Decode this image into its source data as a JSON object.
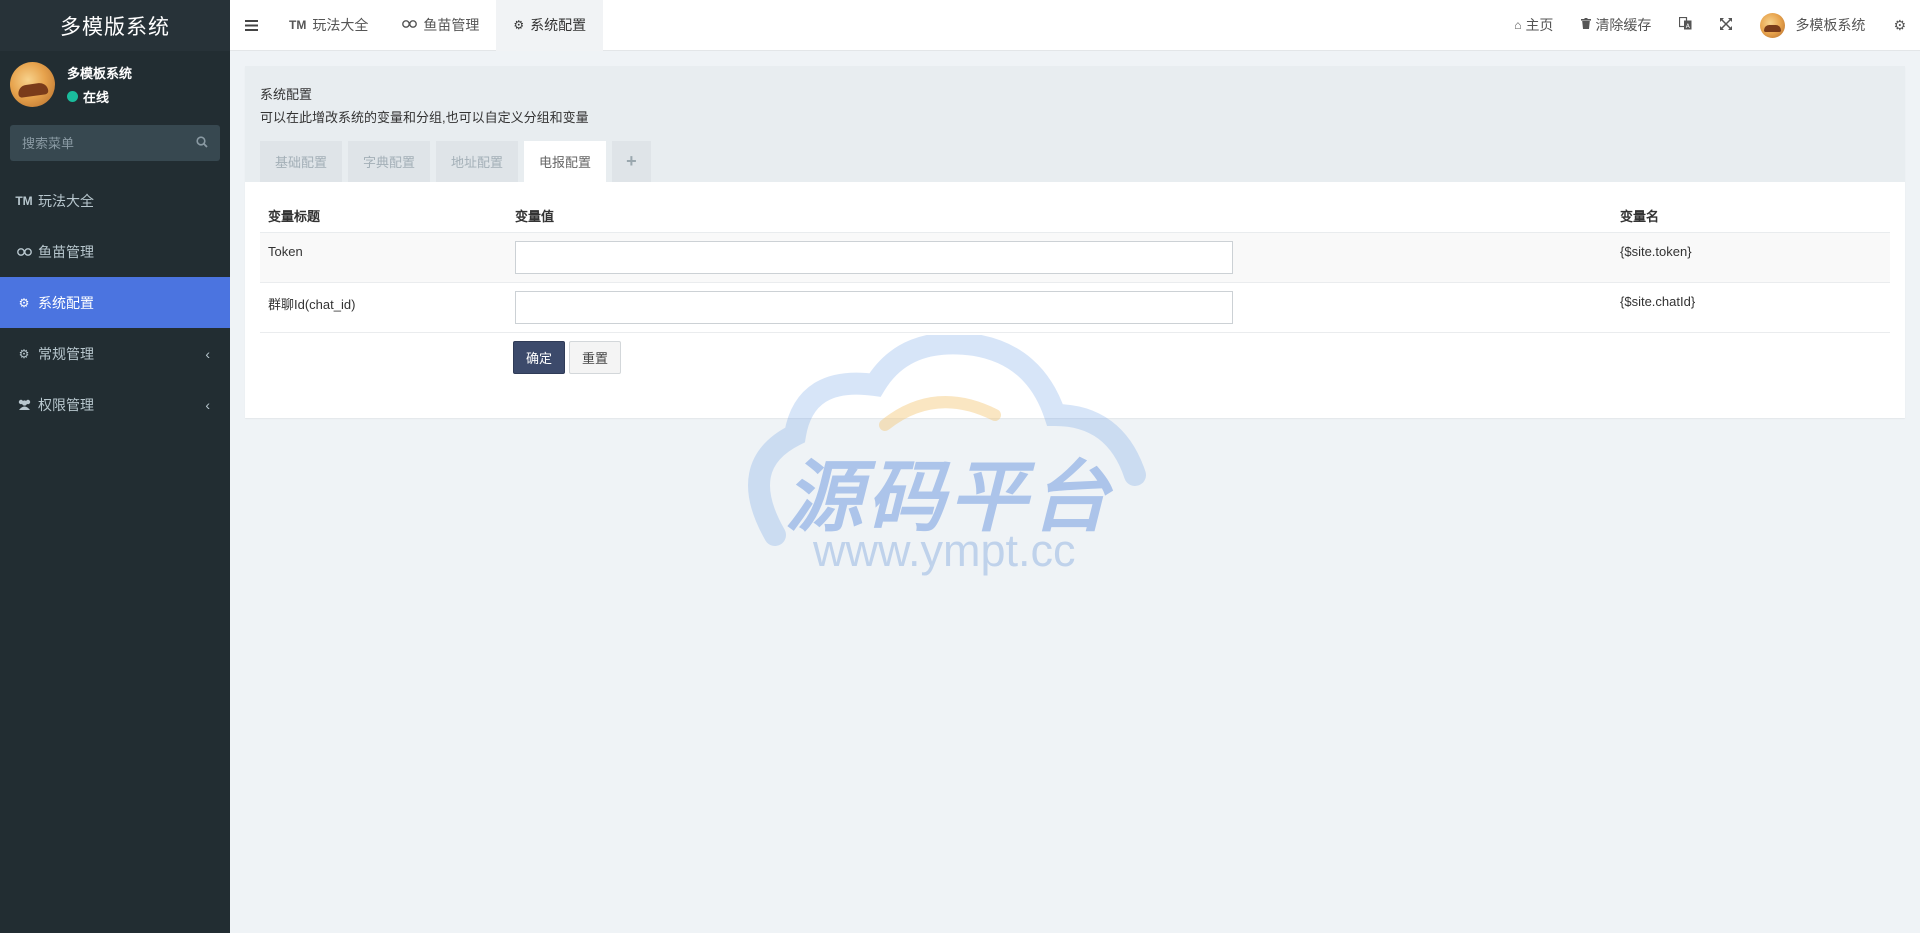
{
  "app": {
    "logo": "多模版系统"
  },
  "user": {
    "name": "多模板系统",
    "status": "在线"
  },
  "search": {
    "placeholder": "搜索菜单"
  },
  "sidebar": {
    "items": [
      {
        "label": "玩法大全",
        "icon": "trademark-icon"
      },
      {
        "label": "鱼苗管理",
        "icon": "binoculars-icon"
      },
      {
        "label": "系统配置",
        "icon": "gear-icon"
      },
      {
        "label": "常规管理",
        "icon": "cogs-icon"
      },
      {
        "label": "权限管理",
        "icon": "users-icon"
      }
    ]
  },
  "navbar": {
    "tabs": [
      {
        "label": "玩法大全"
      },
      {
        "label": "鱼苗管理"
      },
      {
        "label": "系统配置"
      }
    ],
    "home": "主页",
    "clear_cache": "清除缓存",
    "user": "多模板系统"
  },
  "panel": {
    "title": "系统配置",
    "description": "可以在此增改系统的变量和分组,也可以自定义分组和变量",
    "tabs": [
      "基础配置",
      "字典配置",
      "地址配置",
      "电报配置"
    ],
    "add_tab": "+"
  },
  "table": {
    "headers": [
      "变量标题",
      "变量值",
      "变量名"
    ],
    "rows": [
      {
        "title": "Token",
        "value": "",
        "name": "{$site.token}"
      },
      {
        "title": "群聊Id(chat_id)",
        "value": "",
        "name": "{$site.chatId}"
      }
    ]
  },
  "buttons": {
    "submit": "确定",
    "reset": "重置"
  },
  "watermark": {
    "brand": "源码平台",
    "url": "www.ympt.cc"
  },
  "colors": {
    "sidebar_bg": "#222d32",
    "active_menu": "#4b74e0",
    "primary_btn": "#3c4a6b"
  }
}
